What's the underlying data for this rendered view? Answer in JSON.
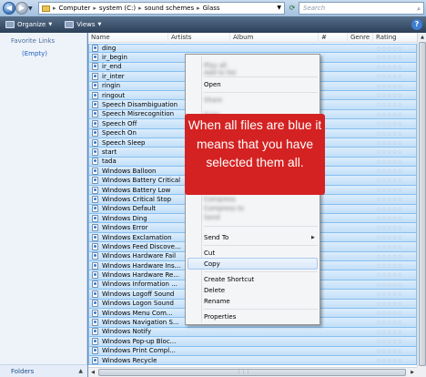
{
  "address_bar": {
    "back_icon": "back-arrow-icon",
    "forward_icon": "forward-arrow-icon",
    "breadcrumbs": [
      "Computer",
      "system (C:)",
      "sound schemes",
      "Glass"
    ],
    "search_placeholder": "Search"
  },
  "toolbar": {
    "organize_label": "Organize",
    "views_label": "Views"
  },
  "nav_pane": {
    "favorite_links_title": "Favorite Links",
    "empty_label": "(Empty)",
    "folders_label": "Folders"
  },
  "columns": {
    "name": "Name",
    "artists": "Artists",
    "album": "Album",
    "number": "#",
    "genre": "Genre",
    "rating": "Rating"
  },
  "files": [
    {
      "name": "ding"
    },
    {
      "name": "ir_begin"
    },
    {
      "name": "ir_end"
    },
    {
      "name": "ir_inter"
    },
    {
      "name": "ringin"
    },
    {
      "name": "ringout"
    },
    {
      "name": "Speech Disambiguation"
    },
    {
      "name": "Speech Misrecognition"
    },
    {
      "name": "Speech Off"
    },
    {
      "name": "Speech On"
    },
    {
      "name": "Speech Sleep"
    },
    {
      "name": "start"
    },
    {
      "name": "tada"
    },
    {
      "name": "Windows Balloon"
    },
    {
      "name": "Windows Battery Critical"
    },
    {
      "name": "Windows Battery Low"
    },
    {
      "name": "Windows Critical Stop"
    },
    {
      "name": "Windows Default"
    },
    {
      "name": "Windows Ding"
    },
    {
      "name": "Windows Error"
    },
    {
      "name": "Windows Exclamation"
    },
    {
      "name": "Windows Feed Discove..."
    },
    {
      "name": "Windows Hardware Fail"
    },
    {
      "name": "Windows Hardware Ins..."
    },
    {
      "name": "Windows Hardware Re..."
    },
    {
      "name": "Windows Information ..."
    },
    {
      "name": "Windows Logoff Sound"
    },
    {
      "name": "Windows Logon Sound"
    },
    {
      "name": "Windows Menu Com..."
    },
    {
      "name": "Windows Navigation S..."
    },
    {
      "name": "Windows Notify"
    },
    {
      "name": "Windows Pop-up Bloc..."
    },
    {
      "name": "Windows Print Compl..."
    },
    {
      "name": "Windows Recycle"
    }
  ],
  "rating_stars": "☆☆☆☆☆",
  "context_menu": {
    "open": "Open",
    "send_to": "Send To",
    "cut": "Cut",
    "copy": "Copy",
    "create_shortcut": "Create Shortcut",
    "delete": "Delete",
    "rename": "Rename",
    "properties": "Properties",
    "highlighted_item": "Copy"
  },
  "annotation": {
    "text": "When all files are blue it means that you have selected them all.",
    "color": "#d42222"
  },
  "selection_color": "#c2dff8"
}
